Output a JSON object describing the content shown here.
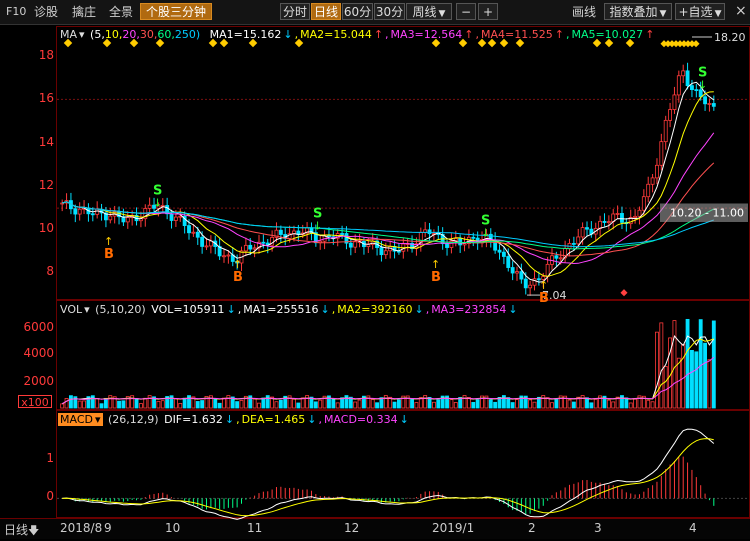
{
  "toolbar": {
    "f10": "F10",
    "zhengu": "诊股",
    "zeshe": "擒庄",
    "quanjing": "全景",
    "fenzhong": "个股三分钟",
    "fenshi": "分时",
    "rixian": "日线",
    "m60": "60分",
    "m30": "30分",
    "zhouxian": "周线",
    "minus": "−",
    "plus": "+",
    "huaxian": "画线",
    "zhishu": "指数叠加",
    "zixuan": "+自选",
    "close": "×"
  },
  "price_panel": {
    "ma_label": "MA",
    "ma_params": [
      "(5,",
      "10,",
      "20,",
      "30,",
      "60,",
      "250)"
    ],
    "ma_values": [
      {
        "text": "MA1=15.162",
        "color": "#ffffff",
        "arrow": "↓",
        "arrow_color": "#00ccff"
      },
      {
        "text": "MA2=15.044",
        "color": "#ffff00",
        "arrow": "↑",
        "arrow_color": "#ff4040"
      },
      {
        "text": "MA3=12.564",
        "color": "#ff44ff",
        "arrow": "↑",
        "arrow_color": "#ff4040"
      },
      {
        "text": "MA4=11.525",
        "color": "#ff5050",
        "arrow": "↑",
        "arrow_color": "#ff4040"
      },
      {
        "text": "MA5=10.027",
        "color": "#00ff88",
        "arrow": "↑",
        "arrow_color": "#ff4040"
      }
    ],
    "y_ticks": [
      "18",
      "16",
      "14",
      "12",
      "10",
      "8"
    ],
    "high_label": "18.20",
    "low_label": "7.04",
    "zone_label": "10.20 - 11.00",
    "buy_mark": "B",
    "sell_mark": "S"
  },
  "vol_panel": {
    "label": "VOL",
    "params": "(5,10,20)",
    "vol": "VOL=105911",
    "ma1": "MA1=255516",
    "ma2": "MA2=392160",
    "ma3": "MA3=232854",
    "y_ticks": [
      "6000",
      "4000",
      "2000"
    ],
    "unit": "x100"
  },
  "macd_panel": {
    "label": "MACD",
    "params": "(26,12,9)",
    "dif": "DIF=1.632",
    "dea": "DEA=1.465",
    "macd": "MACD=0.334",
    "y_ticks": [
      "1",
      "0"
    ]
  },
  "bottom": {
    "period": "日线",
    "x_labels": [
      "2018/8",
      "9",
      "10",
      "11",
      "12",
      "2019/1",
      "2",
      "3",
      "4"
    ]
  },
  "colors": {
    "up": "#ff3a3a",
    "down": "#00e0ff",
    "ma1": "#ffffff",
    "ma2": "#ffff00",
    "ma3": "#ff44ff",
    "ma4": "#ff5050",
    "ma5": "#00ff88"
  },
  "chart_data": {
    "type": "candlestick",
    "x_labels": [
      "2018/8",
      "9",
      "10",
      "11",
      "12",
      "2019/1",
      "2",
      "3",
      "4"
    ],
    "price_range": [
      7,
      18.5
    ],
    "high": 18.2,
    "low": 7.04,
    "close_approx": [
      10.9,
      10.8,
      10.5,
      10.6,
      10.2,
      10.6,
      10.9,
      10.5,
      9.8,
      9.3,
      8.8,
      8.6,
      9.2,
      9.4,
      9.7,
      9.8,
      9.5,
      9.6,
      9.4,
      9.2,
      9.1,
      8.9,
      9.3,
      9.8,
      9.4,
      9.2,
      9.6,
      9.3,
      8.5,
      7.4,
      7.8,
      8.6,
      9.3,
      9.8,
      10.2,
      10.4,
      10.3,
      11.8,
      14.5,
      16.8,
      15.6,
      15.1
    ],
    "vol_range": [
      0,
      6500
    ],
    "macd_range": [
      -0.4,
      1.8
    ],
    "macd_last": {
      "dif": 1.632,
      "dea": 1.465,
      "macd": 0.334
    }
  }
}
